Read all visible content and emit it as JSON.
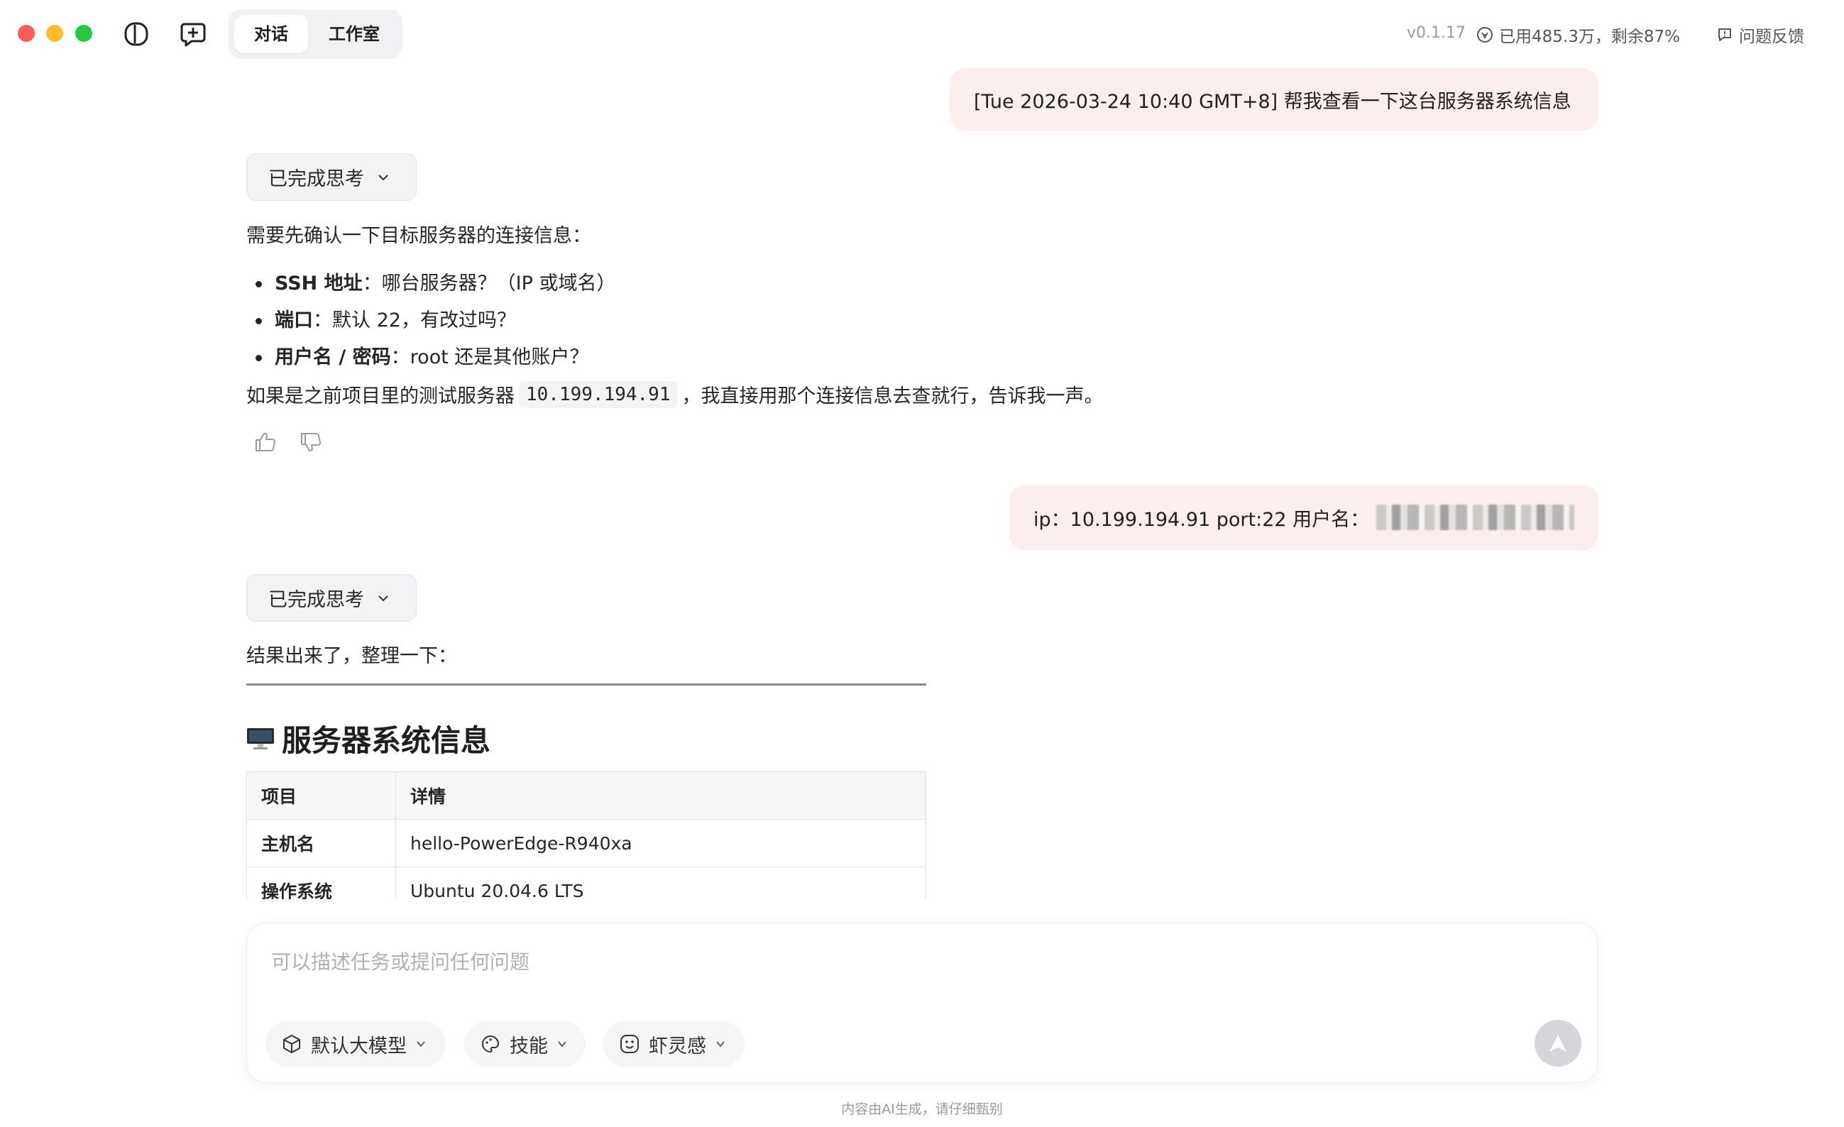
{
  "titlebar": {
    "tabs": [
      {
        "label": "对话",
        "active": true
      },
      {
        "label": "工作室",
        "active": false
      }
    ],
    "version": "v0.1.17",
    "usage": "已用485.3万，剩余87%",
    "feedback": "问题反馈"
  },
  "messages": {
    "user1": "[Tue 2026-03-24 10:40 GMT+8] 帮我查看一下这台服务器系统信息",
    "think_label": "已完成思考",
    "assistant1": {
      "intro": "需要先确认一下目标服务器的连接信息：",
      "items": [
        {
          "bold": "SSH 地址",
          "text": "：哪台服务器？（IP 或域名）"
        },
        {
          "bold": "端口",
          "text": "：默认 22，有改过吗？"
        },
        {
          "bold": "用户名 / 密码",
          "text": "：root 还是其他账户？"
        }
      ],
      "outro_before": "如果是之前项目里的测试服务器",
      "outro_code": "10.199.194.91",
      "outro_after": "，我直接用那个连接信息去查就行，告诉我一声。"
    },
    "user2": "ip：10.199.194.91 port:22 用户名：",
    "assistant2": {
      "intro": "结果出来了，整理一下：",
      "heading": "服务器系统信息",
      "table": {
        "headers": [
          "项目",
          "详情"
        ],
        "rows": [
          [
            "主机名",
            "hello-PowerEdge-R940xa"
          ],
          [
            "操作系统",
            "Ubuntu 20.04.6 LTS"
          ]
        ]
      }
    }
  },
  "composer": {
    "placeholder": "可以描述任务或提问任何问题",
    "chips": [
      "默认大模型",
      "技能",
      "虾灵感"
    ]
  },
  "disclaimer": "内容由AI生成，请仔细甄别",
  "colors": {
    "user_bubble": "#fdeeee",
    "think_bg": "#f3f3f5",
    "send_disabled": "#d6d6da"
  }
}
